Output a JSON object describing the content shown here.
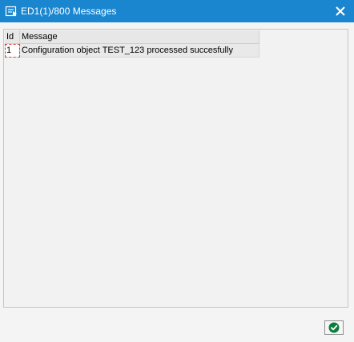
{
  "window": {
    "title": "ED1(1)/800 Messages",
    "title_icon": "message-window-icon",
    "close_icon": "close-icon",
    "colors": {
      "titlebar": "#1a86d0",
      "background": "#f4f4f4"
    }
  },
  "table": {
    "columns": [
      "Id",
      "Message"
    ],
    "rows": [
      {
        "id": "1",
        "message": "Configuration object TEST_123 processed succesfully"
      }
    ]
  },
  "footer": {
    "ok_icon": "green-checkmark-icon",
    "ok_color": "#0a7d3b"
  }
}
